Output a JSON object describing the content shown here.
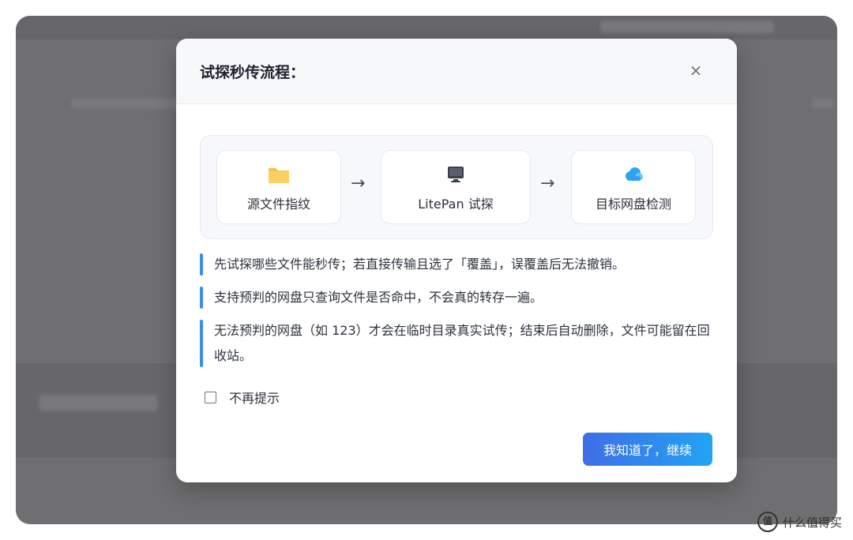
{
  "modal": {
    "title": "试探秒传流程：",
    "close_symbol": "×",
    "flow": [
      {
        "label": "源文件指纹",
        "icon": "folder-icon"
      },
      {
        "label": "LitePan 试探",
        "icon": "monitor-icon"
      },
      {
        "label": "目标网盘检测",
        "icon": "cloud-icon"
      }
    ],
    "arrow_symbol": "→",
    "notes": [
      "先试探哪些文件能秒传；若直接传输且选了「覆盖」，误覆盖后无法撤销。",
      "支持预判的网盘只查询文件是否命中，不会真的转存一遍。",
      "无法预判的网盘（如 123）才会在临时目录真实试传；结束后自动删除，文件可能留在回收站。"
    ],
    "checkbox_label": "不再提示",
    "confirm_label": "我知道了，继续"
  },
  "watermark": {
    "logo_text": "值",
    "text": "什么值得买"
  },
  "colors": {
    "accent": "#3a8bf2",
    "button_start": "#3f6ee6",
    "button_end": "#22a3f5",
    "folder": "#f7c04d",
    "cloud": "#2ea3f2"
  }
}
